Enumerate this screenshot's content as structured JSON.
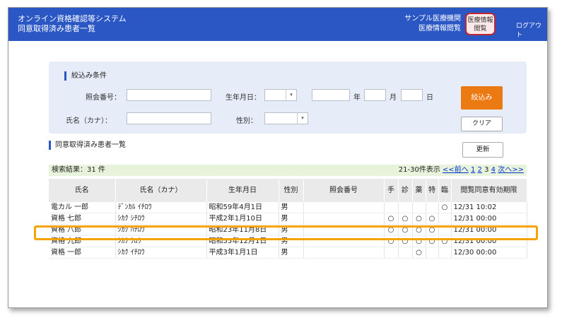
{
  "header": {
    "title_line1": "オンライン資格確認等システム",
    "title_line2": "同意取得済み患者一覧",
    "org_line1": "サンプル医療機関",
    "org_line2": "医療情報閲覧",
    "info_button_line1": "医療情報",
    "info_button_line2": "閲覧",
    "logout": "ログアウト"
  },
  "filter": {
    "title": "絞込み条件",
    "ref_no_label": "照会番号：",
    "name_label": "氏名（カナ）：",
    "birth_label": "生年月日：",
    "year_unit": "年",
    "month_unit": "月",
    "day_unit": "日",
    "sex_label": "性別：",
    "search_button": "絞込み",
    "clear_button": "クリア"
  },
  "list": {
    "title": "同意取得済み患者一覧",
    "update_button": "更新",
    "result_count": "検索結果：31 件",
    "range": "21-30件表示",
    "prev": "<<前へ",
    "page1": "1",
    "page2": "2",
    "page3": "3",
    "page4": "4",
    "next": "次へ>>",
    "columns": [
      "氏名",
      "氏名（カナ）",
      "生年月日",
      "性別",
      "照会番号",
      "手",
      "診",
      "薬",
      "特",
      "臨",
      "閲覧同意有効期限"
    ],
    "rows": [
      {
        "name": "電カル 一郎",
        "kana": "ﾃﾞﾝｶﾙ ｲﾁﾛｳ",
        "birth": "昭和59年4月1日",
        "sex": "男",
        "ref": "",
        "te": "",
        "shin": "",
        "yaku": "",
        "toku": "",
        "rin": "○",
        "expiry": "12/31 10:02"
      },
      {
        "name": "資格 七郎",
        "kana": "ｼｶｸ ｼﾁﾛｳ",
        "birth": "平成2年1月10日",
        "sex": "男",
        "ref": "",
        "te": "○",
        "shin": "○",
        "yaku": "○",
        "toku": "○",
        "rin": "",
        "expiry": "12/31 00:00"
      },
      {
        "name": "資格 八郎",
        "kana": "ｼｶｸ ﾊﾁﾛｳ",
        "birth": "昭和23年11月8日",
        "sex": "男",
        "ref": "",
        "te": "○",
        "shin": "○",
        "yaku": "○",
        "toku": "○",
        "rin": "",
        "expiry": "12/31 00:00"
      },
      {
        "name": "資格 九郎",
        "kana": "ｼｶｸ ｸﾛｳ",
        "birth": "昭和55年12月1日",
        "sex": "男",
        "ref": "",
        "te": "○",
        "shin": "○",
        "yaku": "○",
        "toku": "○",
        "rin": "○",
        "expiry": "12/31 00:00"
      },
      {
        "name": "資格 一郎",
        "kana": "ｼｶｸ ｲﾁﾛｳ",
        "birth": "平成3年1月1日",
        "sex": "男",
        "ref": "",
        "te": "",
        "shin": "",
        "yaku": "○",
        "toku": "",
        "rin": "",
        "expiry": "12/30 00:00"
      }
    ]
  },
  "colors": {
    "header": "#2b57c4",
    "accent": "#ec7a12",
    "highlight": "#f5a300"
  }
}
